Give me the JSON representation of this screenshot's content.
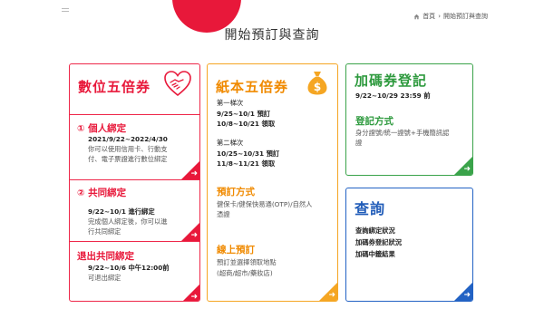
{
  "header": {
    "breadcrumb_home": "首頁",
    "breadcrumb_current": "開始預訂與查詢",
    "page_title": "開始預訂與查詢"
  },
  "digital": {
    "title": "數位五倍券",
    "s1_num": "①",
    "s1_title": "個人綁定",
    "s1_date": "2021/9/22~2022/4/30",
    "s1_desc1": "你可以使用信用卡、行動支",
    "s1_desc2": "付、電子票證進行數位綁定",
    "s2_num": "②",
    "s2_title": "共同綁定",
    "s2_date": "9/22~10/1 進行綁定",
    "s2_desc1": "完成個人綁定後，你可以進",
    "s2_desc2": "行共同綁定",
    "s3_title": "退出共同綁定",
    "s3_date": "9/22~10/6 中午12:00前",
    "s3_desc": "可退出綁定"
  },
  "paper": {
    "title": "紙本五倍券",
    "b1_label": "第一梯次",
    "b1_line1": "9/25~10/1 預訂",
    "b1_line2": "10/8~10/21 領取",
    "b2_label": "第二梯次",
    "b2_line1": "10/25~10/31 預訂",
    "b2_line2": "11/8~11/21 領取",
    "m_title": "預訂方式",
    "m_desc1": "健保卡/健保快易通(OTP)/自然人",
    "m_desc2": "憑證",
    "o_title": "線上預訂",
    "o_desc1": "預訂並選擇領取地點",
    "o_desc2": "(超商/超市/藥妝店)"
  },
  "extra": {
    "title": "加碼券登記",
    "date": "9/22~10/29 23:59 前",
    "sub_title": "登記方式",
    "desc1": "身分證號/統一證號+手機簡訊認",
    "desc2": "證"
  },
  "query": {
    "title": "查詢",
    "item1": "查詢綁定狀況",
    "item2": "加碼券登記狀況",
    "item3": "加碼中籤結果"
  },
  "colors": {
    "red": "#e8183a",
    "orange": "#f5a623",
    "green": "#3aa34a",
    "blue": "#2262c4"
  },
  "icons": [
    "menu-icon",
    "home-icon",
    "heart-handshake-icon",
    "money-bag-icon",
    "arrow-right-icon"
  ]
}
